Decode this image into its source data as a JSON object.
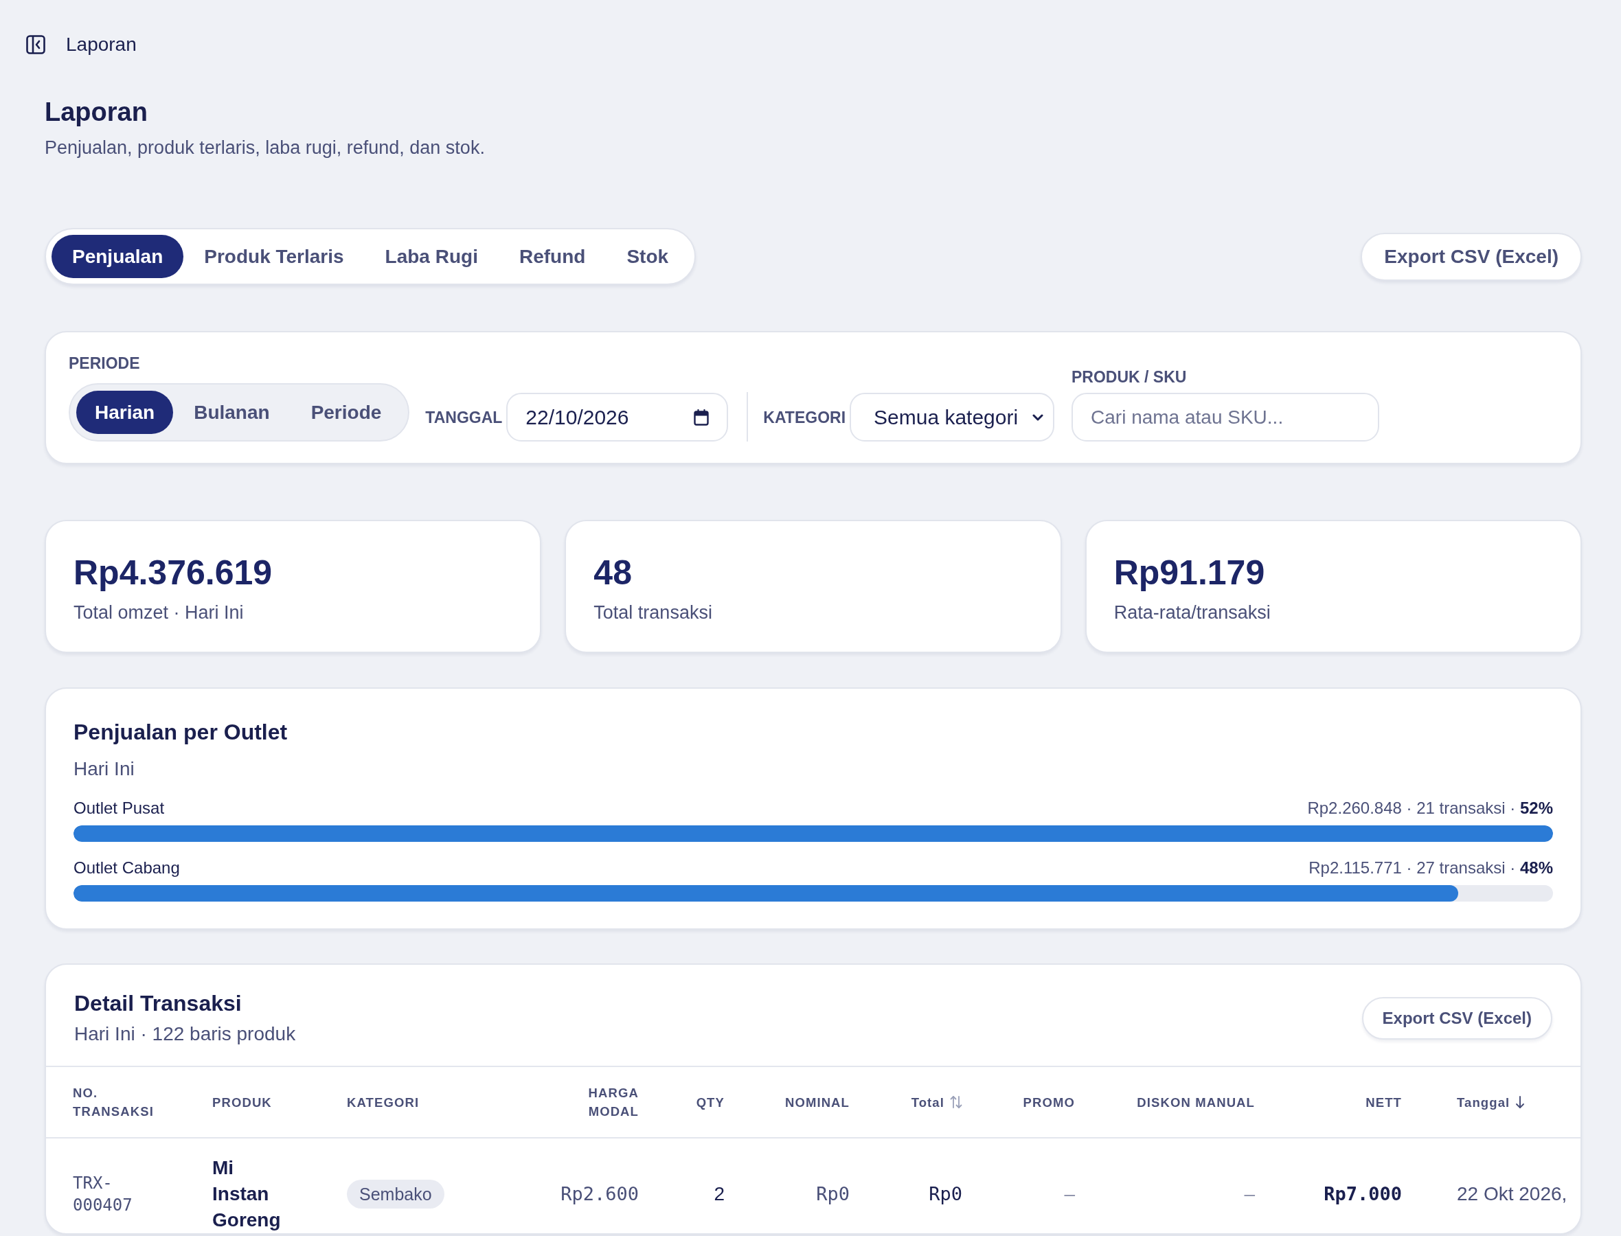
{
  "topbar": {
    "title": "Laporan"
  },
  "page": {
    "title": "Laporan",
    "subtitle": "Penjualan, produk terlaris, laba rugi, refund, dan stok."
  },
  "tabs": [
    {
      "label": "Penjualan",
      "selected": true
    },
    {
      "label": "Produk Terlaris",
      "selected": false
    },
    {
      "label": "Laba Rugi",
      "selected": false
    },
    {
      "label": "Refund",
      "selected": false
    },
    {
      "label": "Stok",
      "selected": false
    }
  ],
  "export_button": "Export CSV (Excel)",
  "filters": {
    "period": {
      "label": "PERIODE",
      "options": [
        {
          "label": "Harian",
          "selected": true
        },
        {
          "label": "Bulanan",
          "selected": false
        },
        {
          "label": "Periode",
          "selected": false
        }
      ]
    },
    "date": {
      "label": "TANGGAL",
      "value": "22/10/2026"
    },
    "category": {
      "label": "KATEGORI",
      "value": "Semua kategori"
    },
    "product": {
      "label": "PRODUK / SKU",
      "placeholder": "Cari nama atau SKU..."
    }
  },
  "stats": [
    {
      "value": "Rp4.376.619",
      "label": "Total omzet · Hari Ini"
    },
    {
      "value": "48",
      "label": "Total transaksi"
    },
    {
      "value": "Rp91.179",
      "label": "Rata-rata/transaksi"
    }
  ],
  "outlet_sales": {
    "title": "Penjualan per Outlet",
    "subtitle": "Hari Ini",
    "outlets": [
      {
        "name": "Outlet Pusat",
        "summary": "Rp2.260.848 · 21 transaksi · **52%**",
        "level": 1
      },
      {
        "name": "Outlet Cabang",
        "summary": "Rp2.115.771 · 27 transaksi · **48%**",
        "level": 0.936
      }
    ]
  },
  "transactions": {
    "title": "Detail Transaksi",
    "subtitle": "Hari Ini · 122 baris produk",
    "export_button": "Export CSV (Excel)",
    "table": {
      "columns": [
        {
          "label": "NO. TRANSAKSI",
          "kind": "code"
        },
        {
          "label": "PRODUK",
          "kind": "product"
        },
        {
          "label": "KATEGORI",
          "kind": "tag"
        },
        {
          "label": "HARGA MODAL",
          "kind": "cost"
        },
        {
          "label": "QTY",
          "kind": "count"
        },
        {
          "label": "NOMINAL",
          "kind": "cost"
        },
        {
          "label": "Total",
          "kind": "amount",
          "sorted": false
        },
        {
          "label": "PROMO",
          "kind": "muted"
        },
        {
          "label": "DISKON MANUAL",
          "kind": "muted"
        },
        {
          "label": "NETT",
          "kind": "net"
        },
        {
          "label": "Tanggal",
          "kind": "date",
          "sorted": true
        }
      ],
      "rows": [
        {
          "cells": [
            "TRX-000407",
            "Mi Instan Goreng",
            "Sembako",
            "Rp2.600",
            "2",
            "Rp0",
            "Rp0",
            "–",
            "–",
            "Rp7.000",
            "22 Okt 2026,"
          ]
        }
      ]
    }
  }
}
